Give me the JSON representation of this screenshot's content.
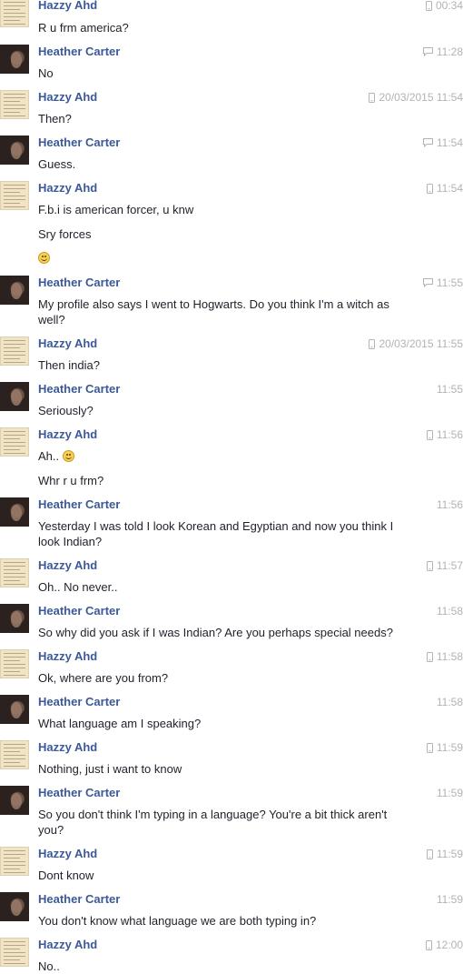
{
  "messages": [
    {
      "sender": "Hazzy Ahd",
      "time": "00:34",
      "via": "mobile",
      "lines": [
        "R u frm america?"
      ]
    },
    {
      "sender": "Heather Carter",
      "time": "11:28",
      "via": "chat",
      "lines": [
        "No"
      ]
    },
    {
      "sender": "Hazzy Ahd",
      "time": "20/03/2015 11:54",
      "via": "mobile",
      "lines": [
        "Then?"
      ]
    },
    {
      "sender": "Heather Carter",
      "time": "11:54",
      "via": "chat",
      "lines": [
        "Guess."
      ]
    },
    {
      "sender": "Hazzy Ahd",
      "time": "11:54",
      "via": "mobile",
      "lines": [
        "F.b.i is american forcer, u knw",
        "Sry forces",
        ""
      ]
    },
    {
      "sender": "Heather Carter",
      "time": "11:55",
      "via": "chat",
      "lines": [
        "My profile also says I went to Hogwarts. Do you think I'm a witch as",
        "well?"
      ]
    },
    {
      "sender": "Hazzy Ahd",
      "time": "20/03/2015 11:55",
      "via": "mobile",
      "lines": [
        "Then india?"
      ]
    },
    {
      "sender": "Heather Carter",
      "time": "11:55",
      "via": "none",
      "lines": [
        "Seriously?"
      ]
    },
    {
      "sender": "Hazzy Ahd",
      "time": "11:56",
      "via": "mobile",
      "lines": [
        "Ah..",
        "Whr r u frm?"
      ]
    },
    {
      "sender": "Heather Carter",
      "time": "11:56",
      "via": "none",
      "lines": [
        "Yesterday I was told I look Korean and Egyptian and now you think I",
        "look Indian?"
      ]
    },
    {
      "sender": "Hazzy Ahd",
      "time": "11:57",
      "via": "mobile",
      "lines": [
        "Oh.. No never.."
      ]
    },
    {
      "sender": "Heather Carter",
      "time": "11:58",
      "via": "none",
      "lines": [
        "So why did you ask if I was Indian? Are you perhaps special needs?"
      ]
    },
    {
      "sender": "Hazzy Ahd",
      "time": "11:58",
      "via": "mobile",
      "lines": [
        "Ok, where are you from?"
      ]
    },
    {
      "sender": "Heather Carter",
      "time": "11:58",
      "via": "none",
      "lines": [
        "What language am I speaking?"
      ]
    },
    {
      "sender": "Hazzy Ahd",
      "time": "11:59",
      "via": "mobile",
      "lines": [
        "Nothing, just i want to know"
      ]
    },
    {
      "sender": "Heather Carter",
      "time": "11:59",
      "via": "none",
      "lines": [
        "So you don't think I'm typing in a language? You're a bit thick aren't",
        "you?"
      ]
    },
    {
      "sender": "Hazzy Ahd",
      "time": "11:59",
      "via": "mobile",
      "lines": [
        "Dont know"
      ]
    },
    {
      "sender": "Heather Carter",
      "time": "11:59",
      "via": "none",
      "lines": [
        "You don't know what language we are both typing in?"
      ]
    },
    {
      "sender": "Hazzy Ahd",
      "time": "12:00",
      "via": "mobile",
      "lines": [
        "No.."
      ]
    }
  ],
  "colors": {
    "name": "#3b5998",
    "text": "#1d2129",
    "time": "#b3b3b3"
  }
}
